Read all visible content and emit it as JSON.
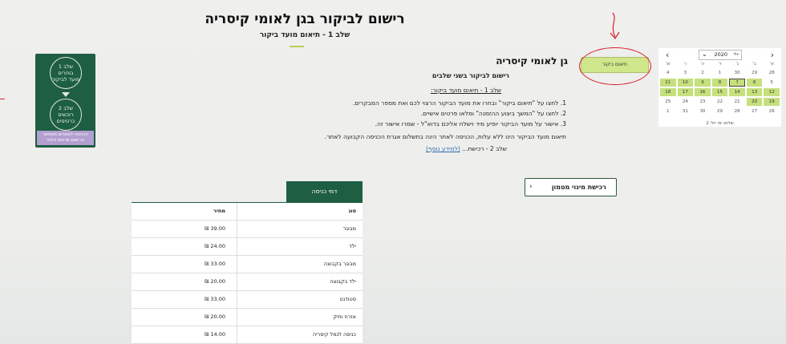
{
  "header": {
    "title": "רישום לביקור בגן לאומי קיסריה",
    "subtitle": "שלב 1 - תיאום מועד ביקור"
  },
  "steps_card": {
    "step1_lines": [
      "שלב 1",
      "בוחרים",
      "מועד לביקור"
    ],
    "step2_lines": [
      "שלב 2",
      "רוכשים",
      "כרטיסים"
    ],
    "note_lines": [
      "הכניסה לאתרים מאפשר",
      "ברישום מראש בלבד"
    ]
  },
  "info": {
    "park_title": "גן לאומי קיסריה",
    "two_steps": "רישום לביקור בשני שלבים",
    "step1_heading": "שלב 1 - תיאום מועד ביקור:",
    "instructions": [
      "1. לחצו על \"תיאום ביקור\" ובחרו את מועד הביקור הרצוי לכם ואת מספר המבקרים.",
      "2. לחצו על \"המשך ביצוע ההזמנה\" ומלאו פרטים אישיים.",
      "3. אישור על מועד הביקור יופיע מיד וישלח אליכם בדוא\"ל - שמרו אישור זה."
    ],
    "note": "תיאום מועד הביקור הינו ללא עלות, הכניסה לאתר הינה בתשלום אגרת הכניסה הקבועה לאתר.",
    "step2_text": "שלב 2 - רכישת...",
    "step2_link": "(למידע נוסף)"
  },
  "booking_button": "תיאום ביקור",
  "calendar": {
    "year": "2020",
    "month_label": "יולי",
    "prev_icon": "chevron-left-icon",
    "next_icon": "chevron-right-icon",
    "weekdays": [
      "א'",
      "ב'",
      "ג'",
      "ד'",
      "ה'",
      "ו'",
      "ש'"
    ],
    "weeks": [
      [
        "28",
        "29",
        "30",
        "1",
        "2",
        "3",
        "4"
      ],
      [
        "5",
        "6",
        "7",
        "8",
        "9",
        "10",
        "11"
      ],
      [
        "12",
        "13",
        "14",
        "15",
        "16",
        "17",
        "18"
      ],
      [
        "19",
        "20",
        "21",
        "22",
        "23",
        "24",
        "25"
      ],
      [
        "26",
        "27",
        "28",
        "29",
        "30",
        "31",
        "1"
      ]
    ],
    "available": [
      "6",
      "7",
      "8",
      "9",
      "10",
      "11",
      "12",
      "13",
      "14",
      "15",
      "16",
      "17",
      "18",
      "19",
      "20"
    ],
    "selected": "7",
    "footer": "שלוש ימי יולי 2"
  },
  "subscription_button": "רכישת מינוי מטמון",
  "prices": {
    "tab_label": "דמי כניסה",
    "columns": {
      "type": "סוג",
      "price": "מחיר"
    },
    "rows": [
      {
        "type": "מבוגר",
        "price": "39.00 ₪"
      },
      {
        "type": "ילד",
        "price": "24.00 ₪"
      },
      {
        "type": "מבוגר בקבוצה",
        "price": "33.00 ₪"
      },
      {
        "type": "ילד בקבוצה",
        "price": "20.00 ₪"
      },
      {
        "type": "סטודנט",
        "price": "33.00 ₪"
      },
      {
        "type": "אזרח ותיק",
        "price": "20.00 ₪"
      },
      {
        "type": "כניסה לנמל קיסריה",
        "price": "14.00 ₪"
      }
    ]
  },
  "colors": {
    "brand_green": "#1e5e42",
    "available_day": "#c5e07c",
    "annotation_red": "#d8212a"
  }
}
